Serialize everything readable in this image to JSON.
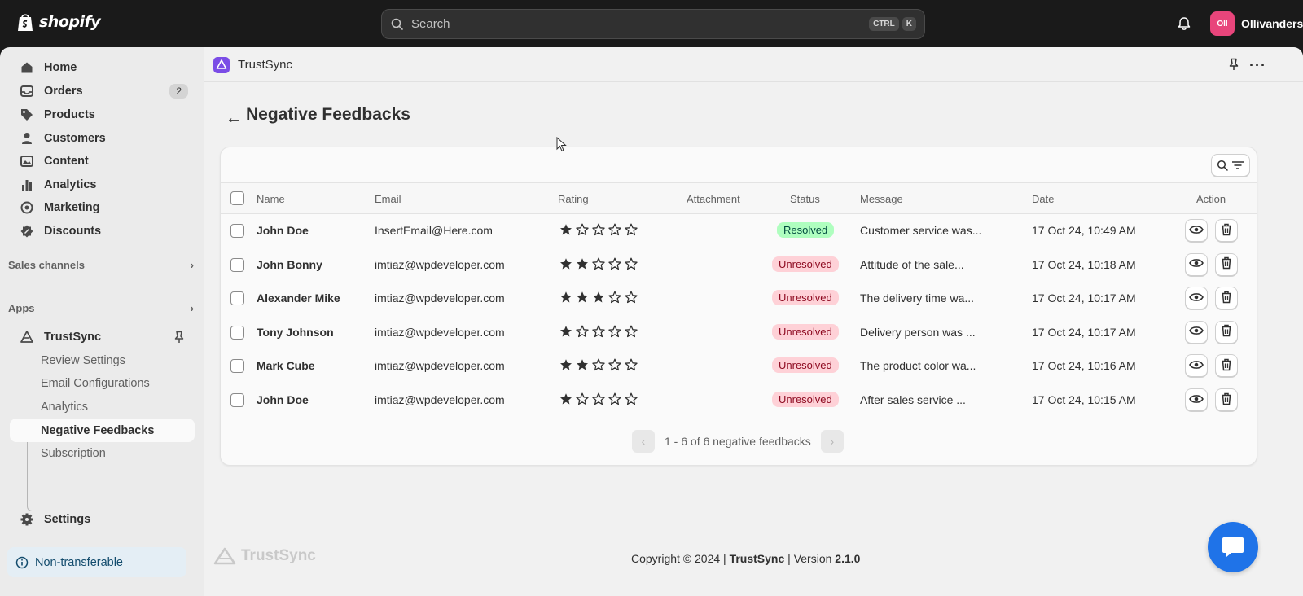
{
  "topbar": {
    "logo_text": "shopify",
    "search_placeholder": "Search",
    "shortcut_keys": [
      "CTRL",
      "K"
    ],
    "store_initials": "Oll",
    "store_name": "Ollivanders",
    "avatar_color": "#e8457b"
  },
  "sidebar": {
    "items": [
      {
        "label": "Home",
        "icon": "home-icon"
      },
      {
        "label": "Orders",
        "icon": "inbox-icon",
        "badge": "2"
      },
      {
        "label": "Products",
        "icon": "tag-icon"
      },
      {
        "label": "Customers",
        "icon": "person-icon"
      },
      {
        "label": "Content",
        "icon": "content-icon"
      },
      {
        "label": "Analytics",
        "icon": "bar-chart-icon"
      },
      {
        "label": "Marketing",
        "icon": "target-icon"
      },
      {
        "label": "Discounts",
        "icon": "discount-icon"
      }
    ],
    "sales_channels": "Sales channels",
    "apps": "Apps",
    "app_name": "TrustSync",
    "app_subitems": [
      "Review Settings",
      "Email Configurations",
      "Analytics",
      "Negative Feedbacks",
      "Subscription"
    ],
    "active_subitem": "Negative Feedbacks",
    "settings": "Settings",
    "non_transferable": "Non-transferable"
  },
  "appbar": {
    "app_name": "TrustSync",
    "app_color": "#7b4de6"
  },
  "page": {
    "title": "Negative Feedbacks"
  },
  "table": {
    "headers": {
      "name": "Name",
      "email": "Email",
      "rating": "Rating",
      "attachment": "Attachment",
      "status": "Status",
      "message": "Message",
      "date": "Date",
      "action": "Action"
    },
    "rows": [
      {
        "name": "John Doe",
        "email": "InsertEmail@Here.com",
        "rating": 1,
        "status": "Resolved",
        "message": "Customer service was...",
        "date": "17 Oct 24, 10:49 AM"
      },
      {
        "name": "John Bonny",
        "email": "imtiaz@wpdeveloper.com",
        "rating": 2,
        "status": "Unresolved",
        "message": "Attitude of the sale...",
        "date": "17 Oct 24, 10:18 AM"
      },
      {
        "name": "Alexander Mike",
        "email": "imtiaz@wpdeveloper.com",
        "rating": 3,
        "status": "Unresolved",
        "message": "The delivery time wa...",
        "date": "17 Oct 24, 10:17 AM"
      },
      {
        "name": "Tony Johnson",
        "email": "imtiaz@wpdeveloper.com",
        "rating": 1,
        "status": "Unresolved",
        "message": "Delivery person was ...",
        "date": "17 Oct 24, 10:17 AM"
      },
      {
        "name": "Mark Cube",
        "email": "imtiaz@wpdeveloper.com",
        "rating": 2,
        "status": "Unresolved",
        "message": "The product color wa...",
        "date": "17 Oct 24, 10:16 AM"
      },
      {
        "name": "John Doe",
        "email": "imtiaz@wpdeveloper.com",
        "rating": 1,
        "status": "Unresolved",
        "message": "After sales service ...",
        "date": "17 Oct 24, 10:15 AM"
      }
    ],
    "max_rating": 5,
    "pagination": "1 - 6 of 6 negative feedbacks"
  },
  "footer": {
    "logo_text": "TrustSync",
    "copyright_prefix": "Copyright © 2024 |",
    "brand": "TrustSync",
    "version_label": "| Version",
    "version": "2.1.0"
  },
  "colors": {
    "resolved_bg": "#affebf",
    "unresolved_bg": "#fed1d7",
    "chat_button": "#1f73e8"
  }
}
